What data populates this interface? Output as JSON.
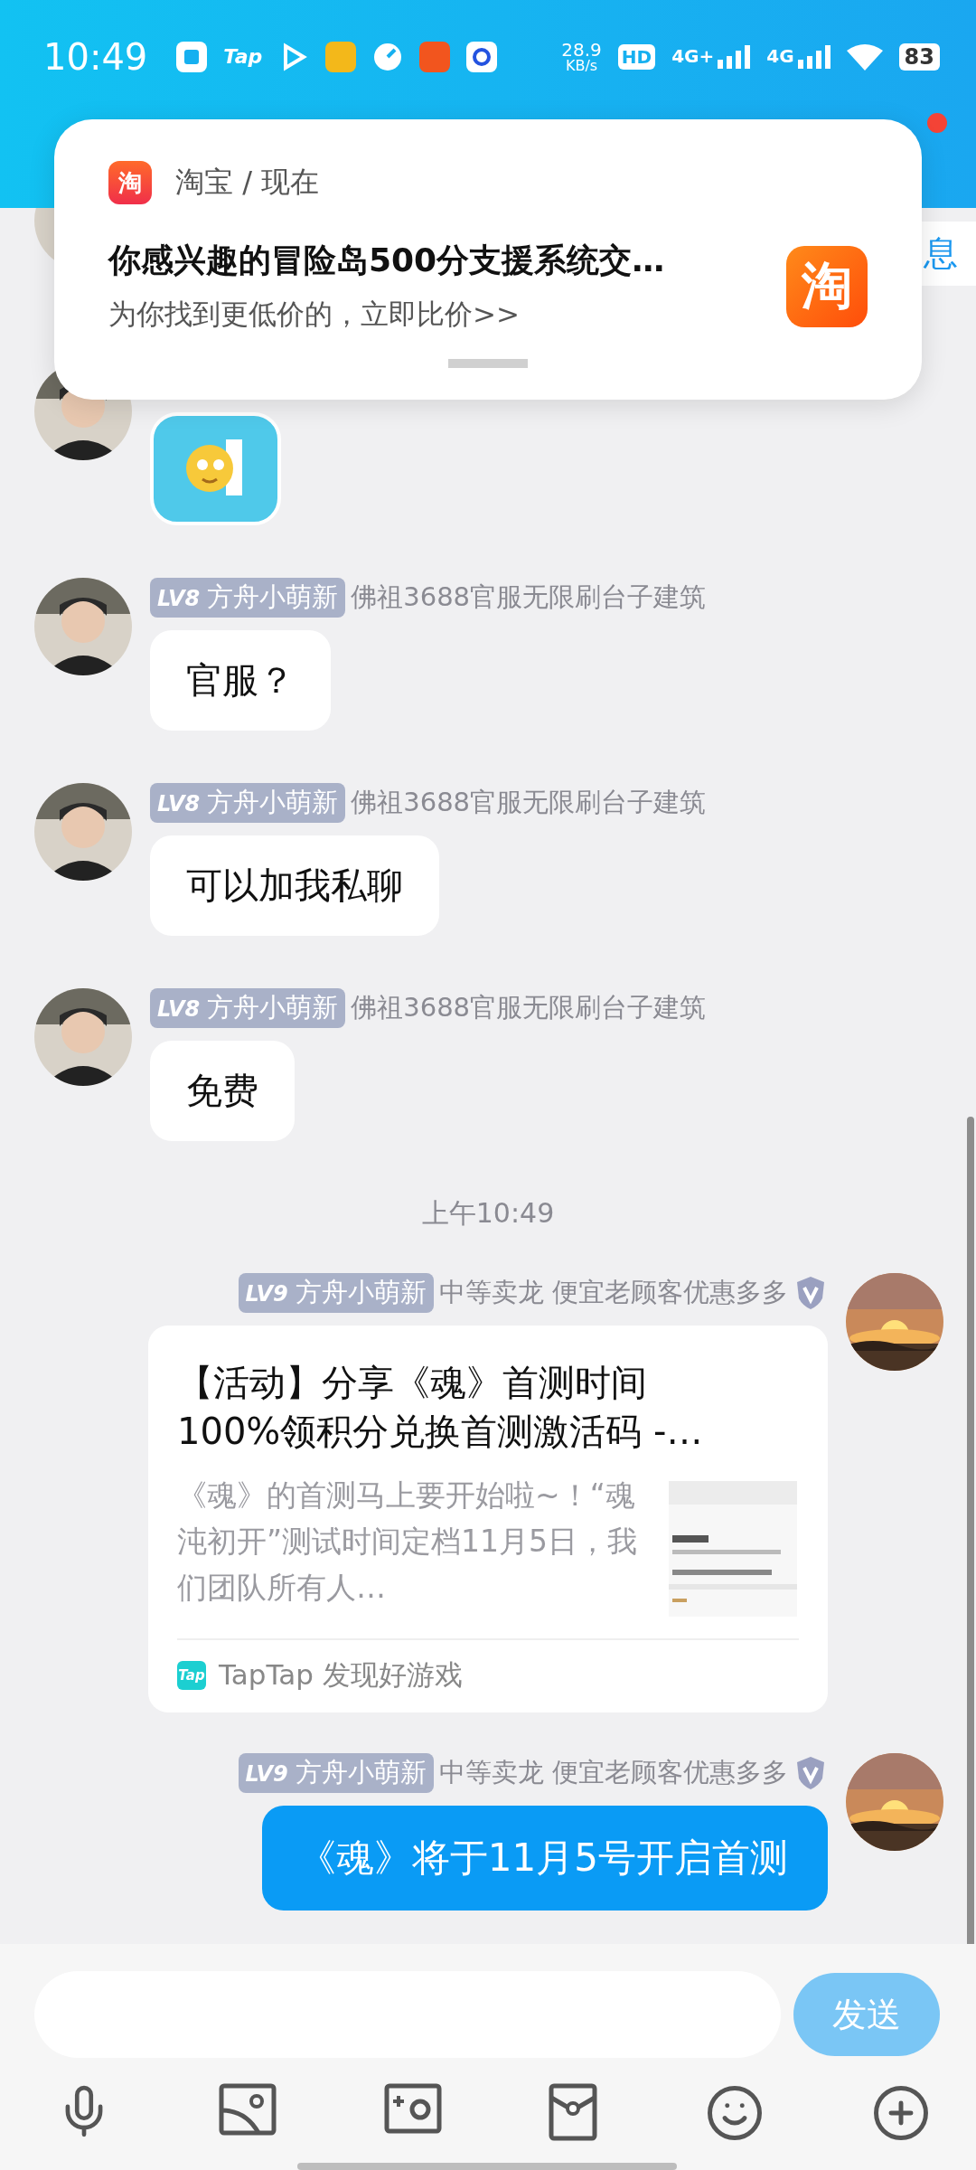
{
  "status_bar": {
    "time": "10:49",
    "tap_logo": "Tap",
    "speed": "28.9",
    "speed_unit": "KB/s",
    "hd": "HD",
    "sim1": "4G+",
    "sim2": "4G",
    "battery": "83"
  },
  "header": {
    "unread": true
  },
  "notification": {
    "app_glyph": "淘",
    "app": "淘宝 / 现在",
    "title": "你感兴趣的冒险岛500分支援系统交…",
    "body": "为你找到更低价的，立即比价>>",
    "logo_glyph": "淘"
  },
  "messages": [
    {
      "kind": "partial",
      "outgoing": false,
      "chip": "息"
    },
    {
      "kind": "sticker",
      "outgoing": false
    },
    {
      "kind": "text",
      "outgoing": false,
      "rank": "LV8",
      "name": "方舟小萌新",
      "title": "佛祖3688官服无限刷台子建筑",
      "verified": false,
      "text": "官服？"
    },
    {
      "kind": "text",
      "outgoing": false,
      "rank": "LV8",
      "name": "方舟小萌新",
      "title": "佛祖3688官服无限刷台子建筑",
      "verified": false,
      "text": "可以加我私聊"
    },
    {
      "kind": "text",
      "outgoing": false,
      "rank": "LV8",
      "name": "方舟小萌新",
      "title": "佛祖3688官服无限刷台子建筑",
      "verified": false,
      "text": "免费"
    },
    {
      "kind": "time",
      "text": "上午10:49"
    },
    {
      "kind": "link_card",
      "outgoing": true,
      "rank": "LV9",
      "name": "方舟小萌新",
      "title": "中等卖龙 便宜老顾客优惠多多",
      "verified": true,
      "card_title": "【活动】分享《魂》首测时间100%领积分兑换首测激活码 -…",
      "card_desc": "《魂》的首测马上要开始啦~！“魂沌初开”测试时间定档11月5日，我们团队所有人…",
      "source_icon": "Tap",
      "source": "TapTap 发现好游戏"
    },
    {
      "kind": "text",
      "outgoing": true,
      "rank": "LV9",
      "name": "方舟小萌新",
      "title": "中等卖龙 便宜老顾客优惠多多",
      "verified": true,
      "text": "《魂》将于11月5号开启首测"
    }
  ],
  "composer": {
    "send": "发送",
    "disabled": true
  }
}
